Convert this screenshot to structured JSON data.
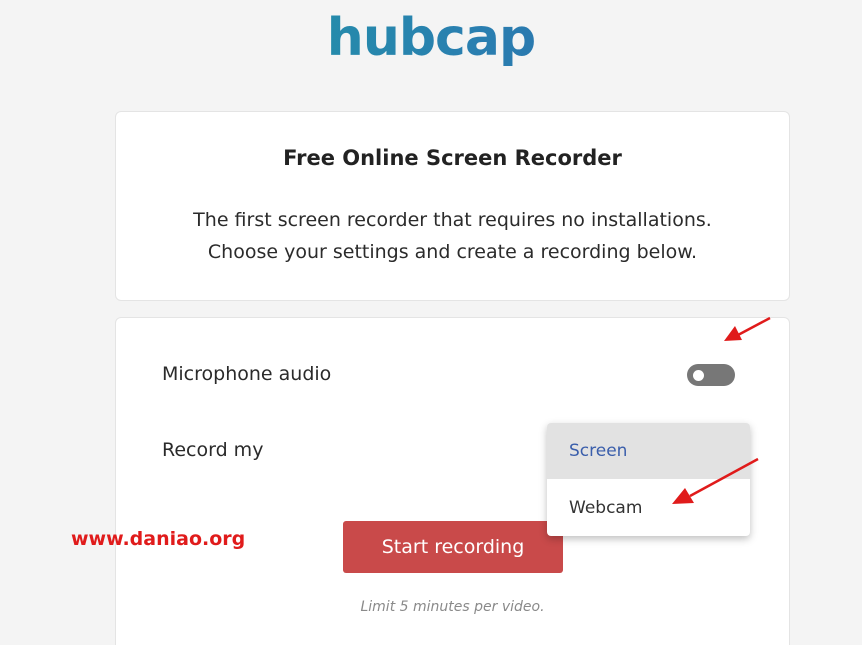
{
  "brand": {
    "logo_text": "hubcap"
  },
  "intro": {
    "title": "Free Online Screen Recorder",
    "line1": "The first screen recorder that requires no installations.",
    "line2": "Choose your settings and create a recording below."
  },
  "settings": {
    "mic_label": "Microphone audio",
    "mic_enabled": false,
    "record_label": "Record my",
    "record_options": [
      "Screen",
      "Webcam"
    ],
    "record_selected": "Screen"
  },
  "actions": {
    "start_label": "Start recording",
    "limit_note": "Limit 5 minutes per video."
  },
  "watermark": {
    "text": "www.daniao.org"
  },
  "colors": {
    "logo_teal": "#1aa3a0",
    "logo_blue": "#2b5ca8",
    "button_red": "#c94a4a",
    "toggle_off": "#777777",
    "selected_option_text": "#3a5eab",
    "annotation_red": "#e01b1b"
  }
}
